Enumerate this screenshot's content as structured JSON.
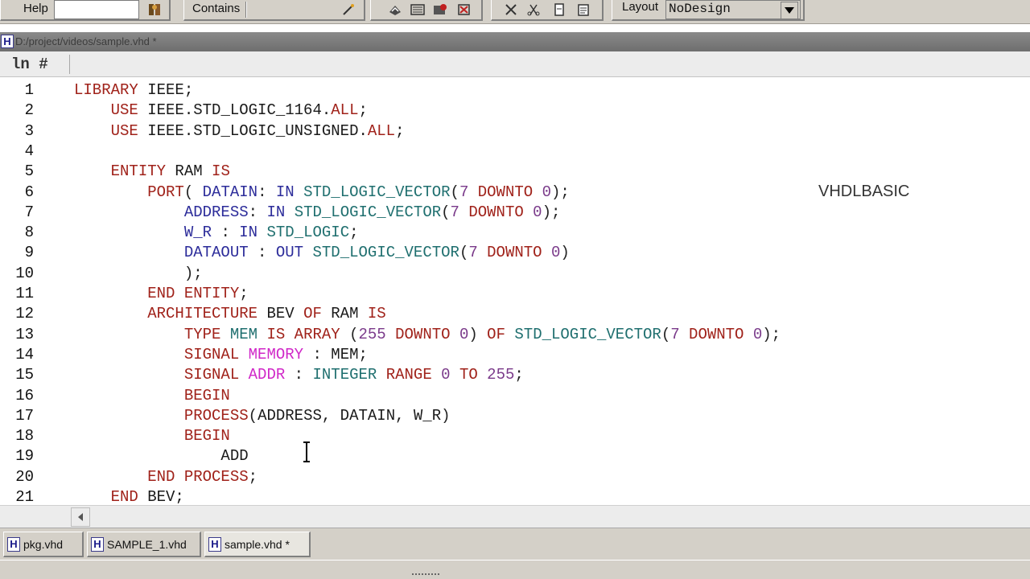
{
  "toolbar": {
    "help_label": "Help",
    "help_search_value": "",
    "contains_label": "Contains",
    "contains_value": "",
    "layout_label": "Layout",
    "layout_value": "NoDesign"
  },
  "editor": {
    "file_path": "D:/project/videos/sample.vhd *",
    "line_header": "ln #",
    "watermark": "VHDLBASIC",
    "lines": [
      {
        "n": "1",
        "tokens": [
          [
            "kw",
            "LIBRARY"
          ],
          [
            "id",
            " IEEE;"
          ]
        ]
      },
      {
        "n": "2",
        "tokens": [
          [
            "id",
            "    "
          ],
          [
            "kw",
            "USE"
          ],
          [
            "id",
            " IEEE.STD_LOGIC_1164."
          ],
          [
            "kw",
            "ALL"
          ],
          [
            "id",
            ";"
          ]
        ]
      },
      {
        "n": "3",
        "tokens": [
          [
            "id",
            "    "
          ],
          [
            "kw",
            "USE"
          ],
          [
            "id",
            " IEEE.STD_LOGIC_UNSIGNED."
          ],
          [
            "kw",
            "ALL"
          ],
          [
            "id",
            ";"
          ]
        ]
      },
      {
        "n": "4",
        "tokens": []
      },
      {
        "n": "5",
        "tokens": [
          [
            "id",
            "    "
          ],
          [
            "kw",
            "ENTITY"
          ],
          [
            "id",
            " RAM "
          ],
          [
            "kw",
            "IS"
          ]
        ]
      },
      {
        "n": "6",
        "tokens": [
          [
            "id",
            "        "
          ],
          [
            "kw",
            "PORT"
          ],
          [
            "punc",
            "( "
          ],
          [
            "port",
            "DATAIN"
          ],
          [
            "punc",
            ": "
          ],
          [
            "port",
            "IN"
          ],
          [
            "punc",
            " "
          ],
          [
            "type",
            "STD_LOGIC_VECTOR"
          ],
          [
            "punc",
            "("
          ],
          [
            "num",
            "7"
          ],
          [
            "punc",
            " "
          ],
          [
            "kw",
            "DOWNTO"
          ],
          [
            "punc",
            " "
          ],
          [
            "num",
            "0"
          ],
          [
            "punc",
            ");"
          ]
        ]
      },
      {
        "n": "7",
        "tokens": [
          [
            "id",
            "            "
          ],
          [
            "port",
            "ADDRESS"
          ],
          [
            "punc",
            ": "
          ],
          [
            "port",
            "IN"
          ],
          [
            "punc",
            " "
          ],
          [
            "type",
            "STD_LOGIC_VECTOR"
          ],
          [
            "punc",
            "("
          ],
          [
            "num",
            "7"
          ],
          [
            "punc",
            " "
          ],
          [
            "kw",
            "DOWNTO"
          ],
          [
            "punc",
            " "
          ],
          [
            "num",
            "0"
          ],
          [
            "punc",
            ");"
          ]
        ]
      },
      {
        "n": "8",
        "tokens": [
          [
            "id",
            "            "
          ],
          [
            "port",
            "W_R"
          ],
          [
            "punc",
            " : "
          ],
          [
            "port",
            "IN"
          ],
          [
            "punc",
            " "
          ],
          [
            "type",
            "STD_LOGIC"
          ],
          [
            "punc",
            ";"
          ]
        ]
      },
      {
        "n": "9",
        "tokens": [
          [
            "id",
            "            "
          ],
          [
            "port",
            "DATAOUT"
          ],
          [
            "punc",
            " : "
          ],
          [
            "port",
            "OUT"
          ],
          [
            "punc",
            " "
          ],
          [
            "type",
            "STD_LOGIC_VECTOR"
          ],
          [
            "punc",
            "("
          ],
          [
            "num",
            "7"
          ],
          [
            "punc",
            " "
          ],
          [
            "kw",
            "DOWNTO"
          ],
          [
            "punc",
            " "
          ],
          [
            "num",
            "0"
          ],
          [
            "punc",
            ")"
          ]
        ]
      },
      {
        "n": "10",
        "tokens": [
          [
            "id",
            "            "
          ],
          [
            "punc",
            ");"
          ]
        ]
      },
      {
        "n": "11",
        "tokens": [
          [
            "id",
            "        "
          ],
          [
            "kw",
            "END ENTITY"
          ],
          [
            "punc",
            ";"
          ]
        ]
      },
      {
        "n": "12",
        "tokens": [
          [
            "id",
            "        "
          ],
          [
            "kw",
            "ARCHITECTURE"
          ],
          [
            "id",
            " BEV "
          ],
          [
            "kw",
            "OF"
          ],
          [
            "id",
            " RAM "
          ],
          [
            "kw",
            "IS"
          ]
        ]
      },
      {
        "n": "13",
        "tokens": [
          [
            "id",
            "            "
          ],
          [
            "kw",
            "TYPE"
          ],
          [
            "id",
            " "
          ],
          [
            "type",
            "MEM"
          ],
          [
            "id",
            " "
          ],
          [
            "kw",
            "IS ARRAY"
          ],
          [
            "punc",
            " ("
          ],
          [
            "num",
            "255"
          ],
          [
            "punc",
            " "
          ],
          [
            "kw",
            "DOWNTO"
          ],
          [
            "punc",
            " "
          ],
          [
            "num",
            "0"
          ],
          [
            "punc",
            ") "
          ],
          [
            "kw",
            "OF"
          ],
          [
            "punc",
            " "
          ],
          [
            "type",
            "STD_LOGIC_VECTOR"
          ],
          [
            "punc",
            "("
          ],
          [
            "num",
            "7"
          ],
          [
            "punc",
            " "
          ],
          [
            "kw",
            "DOWNTO"
          ],
          [
            "punc",
            " "
          ],
          [
            "num",
            "0"
          ],
          [
            "punc",
            ");"
          ]
        ]
      },
      {
        "n": "14",
        "tokens": [
          [
            "id",
            "            "
          ],
          [
            "kw",
            "SIGNAL"
          ],
          [
            "id",
            " "
          ],
          [
            "sig",
            "MEMORY"
          ],
          [
            "punc",
            " : "
          ],
          [
            "id",
            "MEM;"
          ]
        ]
      },
      {
        "n": "15",
        "tokens": [
          [
            "id",
            "            "
          ],
          [
            "kw",
            "SIGNAL"
          ],
          [
            "id",
            " "
          ],
          [
            "sig",
            "ADDR"
          ],
          [
            "punc",
            " : "
          ],
          [
            "type",
            "INTEGER"
          ],
          [
            "punc",
            " "
          ],
          [
            "kw",
            "RANGE"
          ],
          [
            "punc",
            " "
          ],
          [
            "num",
            "0"
          ],
          [
            "punc",
            " "
          ],
          [
            "kw",
            "TO"
          ],
          [
            "punc",
            " "
          ],
          [
            "num",
            "255"
          ],
          [
            "punc",
            ";"
          ]
        ]
      },
      {
        "n": "16",
        "tokens": [
          [
            "id",
            "            "
          ],
          [
            "kw",
            "BEGIN"
          ]
        ]
      },
      {
        "n": "17",
        "tokens": [
          [
            "id",
            "            "
          ],
          [
            "kw",
            "PROCESS"
          ],
          [
            "punc",
            "("
          ],
          [
            "id",
            "ADDRESS, DATAIN, W_R"
          ],
          [
            "punc",
            ")"
          ]
        ]
      },
      {
        "n": "18",
        "tokens": [
          [
            "id",
            "            "
          ],
          [
            "kw",
            "BEGIN"
          ]
        ]
      },
      {
        "n": "19",
        "tokens": [
          [
            "id",
            "                ADD"
          ]
        ]
      },
      {
        "n": "20",
        "tokens": [
          [
            "id",
            "        "
          ],
          [
            "kw",
            "END PROCESS"
          ],
          [
            "punc",
            ";"
          ]
        ]
      },
      {
        "n": "21",
        "tokens": [
          [
            "id",
            "    "
          ],
          [
            "kw",
            "END"
          ],
          [
            "id",
            " BEV;"
          ]
        ]
      }
    ]
  },
  "doc_tabs": [
    {
      "icon": "H",
      "label": "pkg.vhd",
      "active": false
    },
    {
      "icon": "H",
      "label": "SAMPLE_1.vhd",
      "active": false
    },
    {
      "icon": "H",
      "label": "sample.vhd *",
      "active": true
    }
  ],
  "colors": {
    "keyword": "#a0221a",
    "port": "#2c2c9a",
    "type": "#1f6f6f",
    "number": "#7a3a8a",
    "signal": "#d028c8"
  }
}
